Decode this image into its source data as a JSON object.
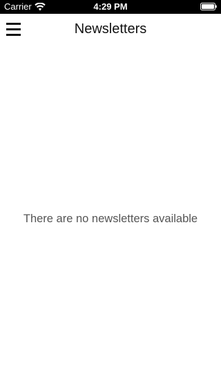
{
  "status_bar": {
    "carrier": "Carrier",
    "time": "4:29 PM",
    "wifi_icon": "wifi-icon",
    "battery_icon": "battery-icon",
    "background_color": "#000000",
    "text_color": "#ffffff"
  },
  "nav_bar": {
    "title": "Newsletters",
    "menu_icon": "hamburger-menu-icon"
  },
  "main": {
    "empty_message": "There are no newsletters available"
  }
}
